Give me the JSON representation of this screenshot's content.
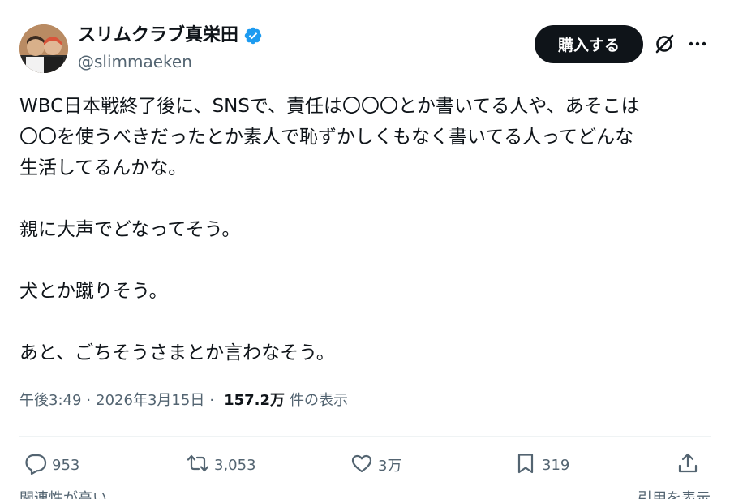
{
  "author": {
    "display_name": "スリムクラブ真栄田",
    "handle": "@slimmaeken",
    "verified": true
  },
  "header": {
    "buy_button_label": "購入する"
  },
  "post": {
    "lines": [
      "WBC日本戦終了後に、SNSで、責任は〇〇〇とか書いてる人や、あそこは",
      "〇〇を使うべきだったとか素人で恥ずかしくもなく書いてる人ってどんな",
      "生活してるんかな。",
      "親に大声でどなってそう。",
      "犬とか蹴りそう。",
      "あと、ごちそうさまとか言わなそう。"
    ]
  },
  "meta": {
    "time": "午後3:49",
    "separator": "·",
    "date": "2026年3月15日",
    "views_count": "157.2万",
    "views_label": "件の表示"
  },
  "actions": {
    "replies": "953",
    "reposts": "3,053",
    "likes": "3万",
    "bookmarks": "319"
  },
  "bottom": {
    "left_text": "関連性が高い",
    "right_text": "引用を表示"
  },
  "colors": {
    "text_primary": "#0f1419",
    "text_secondary": "#536471",
    "verified_blue": "#1d9bf0",
    "button_bg": "#0f1419"
  }
}
